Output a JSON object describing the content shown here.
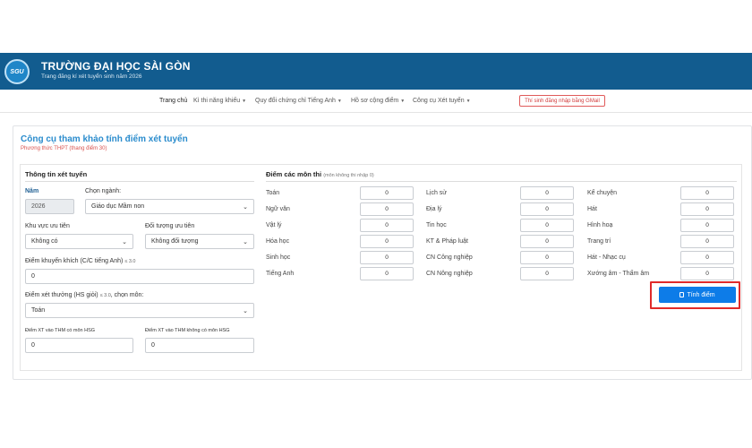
{
  "header": {
    "logo_text": "SGU",
    "title": "TRƯỜNG ĐẠI HỌC SÀI GÒN",
    "subtitle": "Trang đăng kí xét tuyển sinh năm 2026",
    "bg_color": "#125c8f"
  },
  "nav": {
    "items": [
      {
        "label": "Trang chủ",
        "dropdown": false
      },
      {
        "label": "Kì thi năng khiếu",
        "dropdown": true
      },
      {
        "label": "Quy đổi chứng chỉ Tiếng Anh",
        "dropdown": true
      },
      {
        "label": "Hồ sơ cộng điểm",
        "dropdown": true
      },
      {
        "label": "Công cụ Xét tuyển",
        "dropdown": true
      }
    ],
    "login_label": "Thí sinh đăng nhập bằng GMail"
  },
  "tool": {
    "title": "Công cụ tham khảo tính điểm xét tuyển",
    "subtitle": "Phương thức THPT (thang điểm 30)"
  },
  "info": {
    "section_title": "Thông tin xét tuyển",
    "year_label": "Năm",
    "year_value": "2026",
    "major_label": "Chọn ngành:",
    "major_value": "Giáo dục Mầm non",
    "region_label": "Khu vực ưu tiên",
    "region_value": "Không có",
    "priority_label": "Đối tượng ưu tiên",
    "priority_value": "Không đối tượng",
    "encourage_label": "Điểm khuyến khích (C/C tiếng Anh)",
    "encourage_hint": "≤ 3.0",
    "encourage_value": "0",
    "award_label": "Điểm xét thưởng (HS giỏi)",
    "award_hint": "≤ 3.0",
    "award_suffix": ", chọn môn:",
    "award_subject": "Toán",
    "xt_hsg_label": "Điểm XT vào THM có môn HSG",
    "xt_hsg_value": "0",
    "xt_nohsg_label": "Điểm XT vào THM không có môn HSG",
    "xt_nohsg_value": "0"
  },
  "scores": {
    "section_title": "Điểm các môn thi",
    "section_hint": "(môn không thi nhập 0)",
    "col1": [
      {
        "label": "Toán",
        "value": "0"
      },
      {
        "label": "Ngữ văn",
        "value": "0"
      },
      {
        "label": "Vật lý",
        "value": "0"
      },
      {
        "label": "Hóa học",
        "value": "0"
      },
      {
        "label": "Sinh học",
        "value": "0"
      },
      {
        "label": "Tiếng Anh",
        "value": "0"
      }
    ],
    "col2": [
      {
        "label": "Lịch sử",
        "value": "0"
      },
      {
        "label": "Địa lý",
        "value": "0"
      },
      {
        "label": "Tin học",
        "value": "0"
      },
      {
        "label": "KT & Pháp luật",
        "value": "0"
      },
      {
        "label": "CN Công nghiệp",
        "value": "0"
      },
      {
        "label": "CN Nông nghiệp",
        "value": "0"
      }
    ],
    "col3": [
      {
        "label": "Kể chuyện",
        "value": "0"
      },
      {
        "label": "Hát",
        "value": "0"
      },
      {
        "label": "Hình hoạ",
        "value": "0"
      },
      {
        "label": "Trang trí",
        "value": "0"
      },
      {
        "label": "Hát - Nhạc cụ",
        "value": "0"
      },
      {
        "label": "Xướng âm - Thẩm âm",
        "value": "0"
      }
    ],
    "calc_label": "Tính điểm",
    "calc_icon": "calculator-icon",
    "calc_color": "#0d7ce8",
    "highlight_color": "#e02a2a"
  }
}
